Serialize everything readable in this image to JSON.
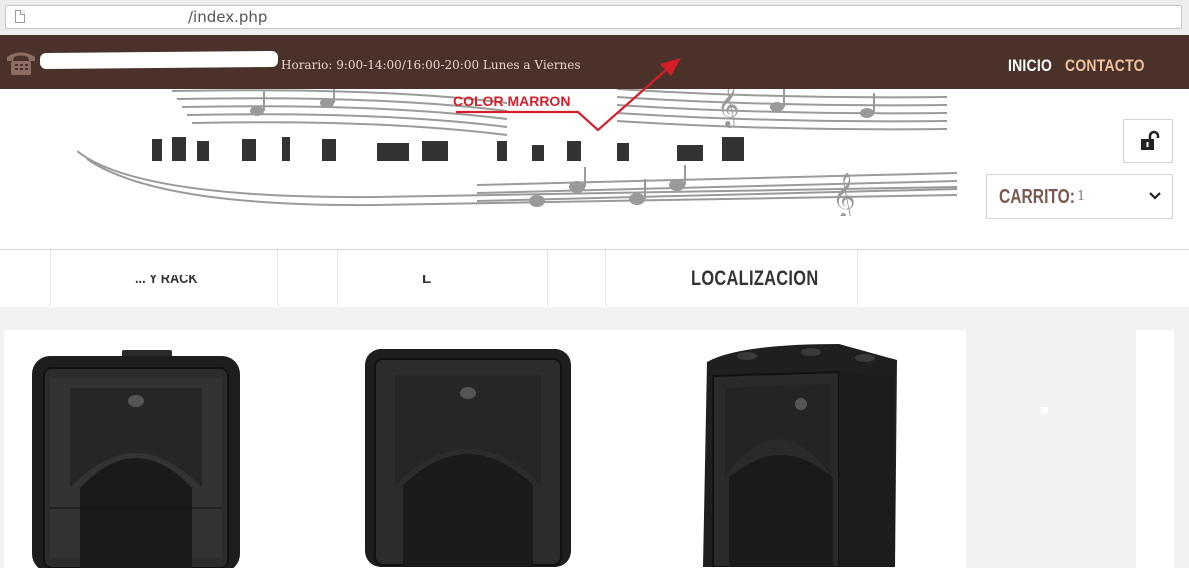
{
  "browser": {
    "url": "/index.php"
  },
  "topbar": {
    "phone_icon": "phone-icon",
    "schedule": "Horario: 9:00-14:00/16:00-20:00 Lunes a Viernes",
    "nav": [
      {
        "label": "INICIO"
      },
      {
        "label": "CONTACTO"
      }
    ],
    "background_color": "#4a312a"
  },
  "annotation": {
    "label": "COLOR MARRON",
    "color": "#d41f2b"
  },
  "header": {
    "lock_icon": "unlock-icon",
    "cart": {
      "label": "CARRITO:",
      "count": "1",
      "chevron_icon": "chevron-down-icon"
    }
  },
  "menu": {
    "items": [
      {
        "label": "... Y RACK"
      },
      {
        "label": "L"
      },
      {
        "label": "LOCALIZACION"
      }
    ]
  },
  "products": {
    "items": [
      {
        "name": "speaker-1"
      },
      {
        "name": "speaker-2"
      },
      {
        "name": "speaker-3"
      }
    ]
  }
}
